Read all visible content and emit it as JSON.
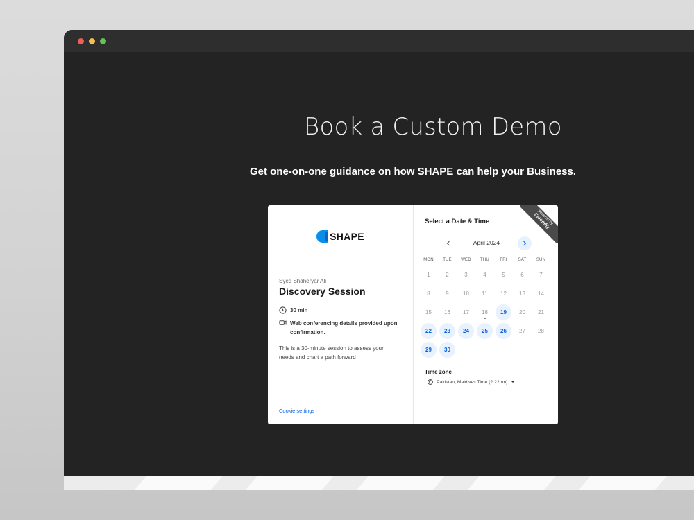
{
  "hero": {
    "title": "Book a Custom Demo",
    "subtitle": "Get one-on-one guidance on how SHAPE can help your Business."
  },
  "brand": {
    "logo_text": "SHAPE",
    "accent": "#0a66e8"
  },
  "event": {
    "organizer": "Syed Shaheryar Ali",
    "title": "Discovery Session",
    "duration": "30 min",
    "conferencing": "Web conferencing details provided upon confirmation.",
    "description": "This is a 30-minute session to assess your needs and chart a path forward",
    "cookie_settings": "Cookie settings"
  },
  "calendar": {
    "heading": "Select a Date & Time",
    "month": "April 2024",
    "prev_icon": "chevron-left-icon",
    "next_icon": "chevron-right-icon",
    "weekdays": [
      "MON",
      "TUE",
      "WED",
      "THU",
      "FRI",
      "SAT",
      "SUN"
    ],
    "days": [
      {
        "d": "1"
      },
      {
        "d": "2"
      },
      {
        "d": "3"
      },
      {
        "d": "4"
      },
      {
        "d": "5"
      },
      {
        "d": "6"
      },
      {
        "d": "7"
      },
      {
        "d": "8"
      },
      {
        "d": "9"
      },
      {
        "d": "10"
      },
      {
        "d": "11"
      },
      {
        "d": "12"
      },
      {
        "d": "13"
      },
      {
        "d": "14"
      },
      {
        "d": "15"
      },
      {
        "d": "16"
      },
      {
        "d": "17"
      },
      {
        "d": "18",
        "today": true
      },
      {
        "d": "19",
        "available": true
      },
      {
        "d": "20"
      },
      {
        "d": "21"
      },
      {
        "d": "22",
        "available": true
      },
      {
        "d": "23",
        "available": true
      },
      {
        "d": "24",
        "available": true
      },
      {
        "d": "25",
        "available": true
      },
      {
        "d": "26",
        "available": true
      },
      {
        "d": "27"
      },
      {
        "d": "28"
      },
      {
        "d": "29",
        "available": true
      },
      {
        "d": "30",
        "available": true
      }
    ],
    "timezone_label": "Time zone",
    "timezone_value": "Pakistan, Maldives Time (2:22pm)"
  },
  "badge": {
    "top": "powered by",
    "name": "Calendly"
  }
}
